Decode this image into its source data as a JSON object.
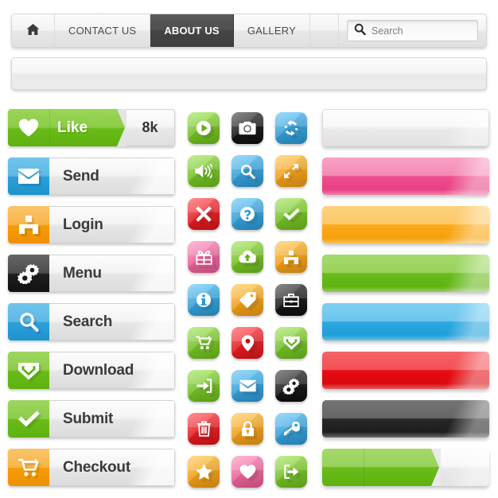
{
  "navbar": {
    "home_icon": "home-icon",
    "tabs": [
      {
        "label": "CONTACT US",
        "active": false
      },
      {
        "label": "ABOUT US",
        "active": true
      },
      {
        "label": "GALLERY",
        "active": false
      }
    ],
    "search": {
      "icon": "search-icon",
      "placeholder": "Search",
      "value": "Search"
    }
  },
  "navbar_empty": {
    "label": ""
  },
  "left_buttons": [
    {
      "label": "Like",
      "count": "8k",
      "icon": "heart-icon",
      "color": "#7cc62e",
      "type": "like"
    },
    {
      "label": "Send",
      "icon": "envelope-icon",
      "color": "#3ca5dd",
      "type": "standard"
    },
    {
      "label": "Login",
      "icon": "login-person-icon",
      "color": "#f5a623",
      "type": "standard"
    },
    {
      "label": "Menu",
      "icon": "gears-icon",
      "color": "#2b2b2b",
      "type": "standard"
    },
    {
      "label": "Search",
      "icon": "magnifier-icon",
      "color": "#3ca5dd",
      "type": "standard"
    },
    {
      "label": "Download",
      "icon": "download-shield-icon",
      "color": "#7cc62e",
      "type": "standard"
    },
    {
      "label": "Submit",
      "icon": "check-icon",
      "color": "#7cc62e",
      "type": "standard"
    },
    {
      "label": "Checkout",
      "icon": "shopping-cart-icon",
      "color": "#f5a623",
      "type": "standard"
    }
  ],
  "icon_grid": {
    "columns": 3,
    "rows": 9,
    "tiles": [
      {
        "name": "play-icon",
        "color": "#7cc62e"
      },
      {
        "name": "camera-icon",
        "color": "#1f1f1f"
      },
      {
        "name": "refresh-icon",
        "color": "#3ca5dd"
      },
      {
        "name": "volume-icon",
        "color": "#7cc62e"
      },
      {
        "name": "search-icon",
        "color": "#3ca5dd"
      },
      {
        "name": "expand-arrows-icon",
        "color": "#f5a623"
      },
      {
        "name": "close-x-icon",
        "color": "#e8252a"
      },
      {
        "name": "help-question-icon",
        "color": "#3ca5dd"
      },
      {
        "name": "checkmark-icon",
        "color": "#7cc62e"
      },
      {
        "name": "gift-icon",
        "color": "#ef6ba0"
      },
      {
        "name": "cloud-upload-icon",
        "color": "#7cc62e"
      },
      {
        "name": "login-person-icon",
        "color": "#f5a623"
      },
      {
        "name": "info-icon",
        "color": "#3ca5dd"
      },
      {
        "name": "price-tag-icon",
        "color": "#f5a623"
      },
      {
        "name": "briefcase-icon",
        "color": "#1f1f1f"
      },
      {
        "name": "shopping-cart-icon",
        "color": "#7cc62e"
      },
      {
        "name": "map-pin-icon",
        "color": "#e8252a"
      },
      {
        "name": "download-shield-icon",
        "color": "#7cc62e"
      },
      {
        "name": "sign-in-icon",
        "color": "#7cc62e"
      },
      {
        "name": "envelope-icon",
        "color": "#3ca5dd"
      },
      {
        "name": "gears-icon",
        "color": "#1f1f1f"
      },
      {
        "name": "trash-icon",
        "color": "#e8252a"
      },
      {
        "name": "lock-icon",
        "color": "#f5a623"
      },
      {
        "name": "key-icon",
        "color": "#3ca5dd"
      },
      {
        "name": "star-icon",
        "color": "#f5a623"
      },
      {
        "name": "heart-icon",
        "color": "#ef6ba0"
      },
      {
        "name": "sign-out-icon",
        "color": "#7cc62e"
      }
    ]
  },
  "right_bars": [
    {
      "name": "bar-white",
      "color": "#f0f0f0",
      "top": "#fdfdfd",
      "bottom": "#e2e2e2",
      "type": "plain"
    },
    {
      "name": "bar-pink",
      "color": "#ef5f9a",
      "top": "#f57fae",
      "bottom": "#e8367f",
      "type": "plain"
    },
    {
      "name": "bar-orange",
      "color": "#f9b233",
      "top": "#fcc košile",
      "bottom": "#f59c00",
      "type": "plain"
    },
    {
      "name": "bar-green",
      "color": "#6fc425",
      "top": "#8ed046",
      "bottom": "#55ad0c",
      "type": "plain"
    },
    {
      "name": "bar-blue",
      "color": "#3bb0e3",
      "top": "#5cc2ed",
      "bottom": "#1f9ad4",
      "type": "plain"
    },
    {
      "name": "bar-red",
      "color": "#e8252a",
      "top": "#f24044",
      "bottom": "#cf0d14",
      "type": "plain"
    },
    {
      "name": "bar-black",
      "color": "#2e2e2e",
      "top": "#4a4a4a",
      "bottom": "#141414",
      "type": "plain"
    },
    {
      "name": "bar-like-empty",
      "color": "#7cc62e",
      "type": "like-empty"
    }
  ]
}
